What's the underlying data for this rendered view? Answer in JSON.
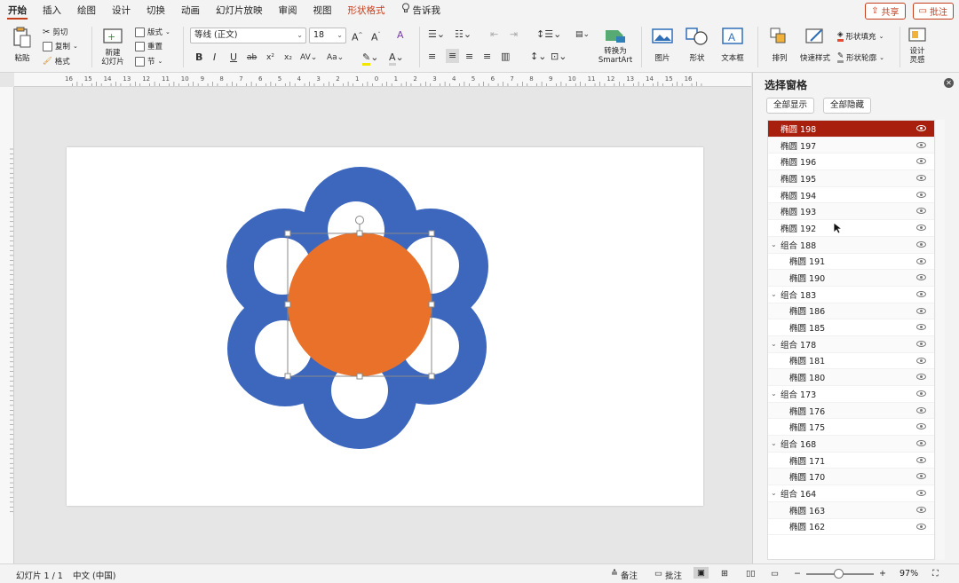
{
  "tabs": [
    {
      "label": "开始",
      "active": true
    },
    {
      "label": "插入"
    },
    {
      "label": "绘图"
    },
    {
      "label": "设计"
    },
    {
      "label": "切换"
    },
    {
      "label": "动画"
    },
    {
      "label": "幻灯片放映"
    },
    {
      "label": "审阅"
    },
    {
      "label": "视图"
    },
    {
      "label": "形状格式",
      "context": true
    }
  ],
  "tell_me": "告诉我",
  "share_label": "共享",
  "comments_label": "批注",
  "ribbon": {
    "paste": "粘贴",
    "cut": "剪切",
    "copy": "复制",
    "format": "格式",
    "new_slide_l1": "新建",
    "new_slide_l2": "幻灯片",
    "layout": "版式",
    "reset": "重置",
    "section": "节",
    "font_name": "等线 (正文)",
    "font_size": "18",
    "convert_smartart_l1": "转换为",
    "convert_smartart_l2": "SmartArt",
    "picture": "图片",
    "shape": "形状",
    "textbox": "文本框",
    "arrange": "排列",
    "quick_styles": "快速样式",
    "shape_fill": "形状填充",
    "shape_outline": "形状轮廓",
    "design_ideas_l1": "设计",
    "design_ideas_l2": "灵感"
  },
  "ruler_labels": [
    "16",
    "15",
    "14",
    "13",
    "12",
    "11",
    "10",
    "9",
    "8",
    "7",
    "6",
    "5",
    "4",
    "3",
    "2",
    "1",
    "0",
    "1",
    "2",
    "3",
    "4",
    "5",
    "6",
    "7",
    "8",
    "9",
    "10",
    "11",
    "12",
    "13",
    "14",
    "15",
    "16"
  ],
  "selection_pane": {
    "title": "选择窗格",
    "show_all": "全部显示",
    "hide_all": "全部隐藏",
    "items": [
      {
        "name": "椭圆 198",
        "level": 0,
        "selected": true
      },
      {
        "name": "椭圆 197",
        "level": 0
      },
      {
        "name": "椭圆 196",
        "level": 0
      },
      {
        "name": "椭圆 195",
        "level": 0
      },
      {
        "name": "椭圆 194",
        "level": 0
      },
      {
        "name": "椭圆 193",
        "level": 0
      },
      {
        "name": "椭圆 192",
        "level": 0
      },
      {
        "name": "组合 188",
        "level": 0,
        "group": true
      },
      {
        "name": "椭圆 191",
        "level": 1
      },
      {
        "name": "椭圆 190",
        "level": 1
      },
      {
        "name": "组合 183",
        "level": 0,
        "group": true
      },
      {
        "name": "椭圆 186",
        "level": 1
      },
      {
        "name": "椭圆 185",
        "level": 1
      },
      {
        "name": "组合 178",
        "level": 0,
        "group": true
      },
      {
        "name": "椭圆 181",
        "level": 1
      },
      {
        "name": "椭圆 180",
        "level": 1
      },
      {
        "name": "组合 173",
        "level": 0,
        "group": true
      },
      {
        "name": "椭圆 176",
        "level": 1
      },
      {
        "name": "椭圆 175",
        "level": 1
      },
      {
        "name": "组合 168",
        "level": 0,
        "group": true
      },
      {
        "name": "椭圆 171",
        "level": 1
      },
      {
        "name": "椭圆 170",
        "level": 1
      },
      {
        "name": "组合 164",
        "level": 0,
        "group": true
      },
      {
        "name": "椭圆 163",
        "level": 1
      },
      {
        "name": "椭圆 162",
        "level": 1
      }
    ]
  },
  "status": {
    "slide": "幻灯片 1 / 1",
    "language": "中文 (中国)",
    "notes": "备注",
    "comments": "批注",
    "zoom": "97%"
  },
  "colors": {
    "accent": "#c43e1c",
    "selected_row": "#a8200d",
    "flower_blue": "#3d67bd",
    "center_orange": "#e9712a"
  }
}
